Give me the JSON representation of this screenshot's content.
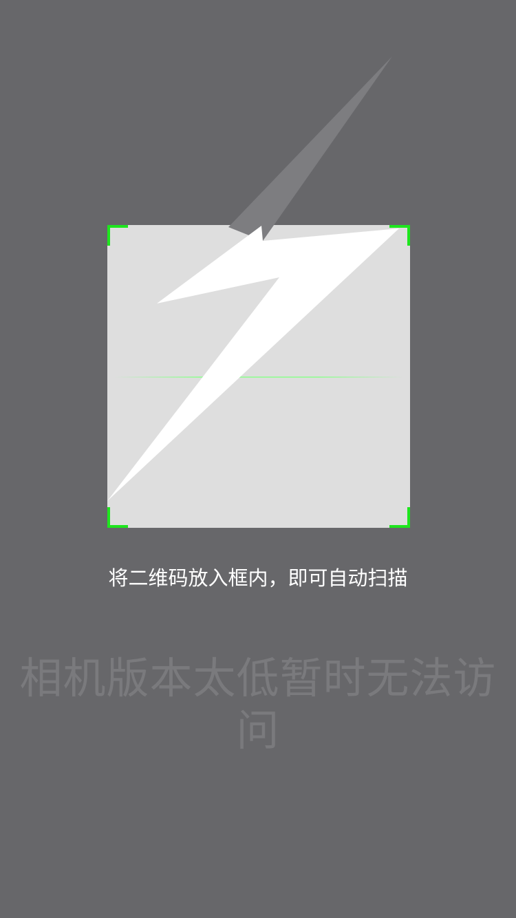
{
  "colors": {
    "background": "#67676a",
    "scan_area": "#dedede",
    "corner": "#1ee61e",
    "scan_line": "#9ff79f",
    "flash_icon": "#ffffff",
    "flash_shadow": "#7d7d80",
    "hint_text": "#ffffff",
    "error_text": "#7a7a7d"
  },
  "icons": {
    "flash": "lightning-bolt-icon"
  },
  "scanner": {
    "hint": "将二维码放入框内，即可自动扫描"
  },
  "error": {
    "message": "相机版本太低暂时无法访问"
  }
}
